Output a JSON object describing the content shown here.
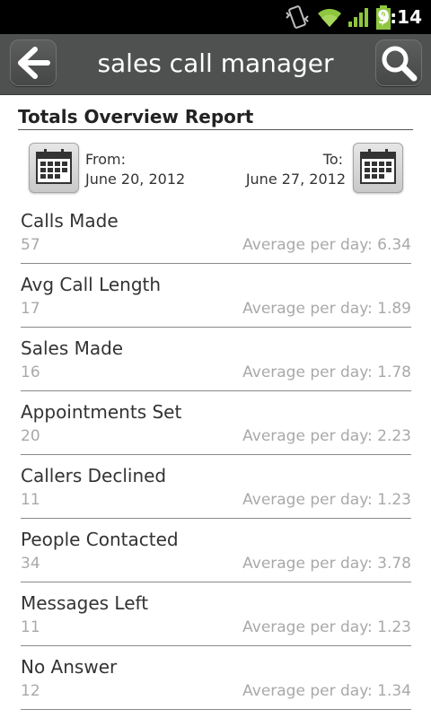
{
  "status_bar": {
    "time": "9:14",
    "icons": [
      "vibrate-icon",
      "wifi-icon",
      "signal-icon",
      "battery-charging-icon"
    ]
  },
  "action_bar": {
    "title": "sales call manager",
    "back_icon": "back-arrow-icon",
    "search_icon": "search-icon"
  },
  "report": {
    "title": "Totals Overview Report",
    "from_label": "From:",
    "from_date": "June 20, 2012",
    "to_label": "To:",
    "to_date": "June 27, 2012",
    "calendar_icon": "calendar-icon"
  },
  "metrics": [
    {
      "name": "Calls Made",
      "value": "57",
      "average": "Average per day: 6.34"
    },
    {
      "name": "Avg Call Length",
      "value": "17",
      "average": "Average per day: 1.89"
    },
    {
      "name": "Sales Made",
      "value": "16",
      "average": "Average per day: 1.78"
    },
    {
      "name": "Appointments Set",
      "value": "20",
      "average": "Average per day: 2.23"
    },
    {
      "name": "Callers Declined",
      "value": "11",
      "average": "Average per day: 1.23"
    },
    {
      "name": "People Contacted",
      "value": "34",
      "average": "Average per day: 3.78"
    },
    {
      "name": "Messages Left",
      "value": "11",
      "average": "Average per day: 1.23"
    },
    {
      "name": "No Answer",
      "value": "12",
      "average": "Average per day: 1.34"
    }
  ]
}
